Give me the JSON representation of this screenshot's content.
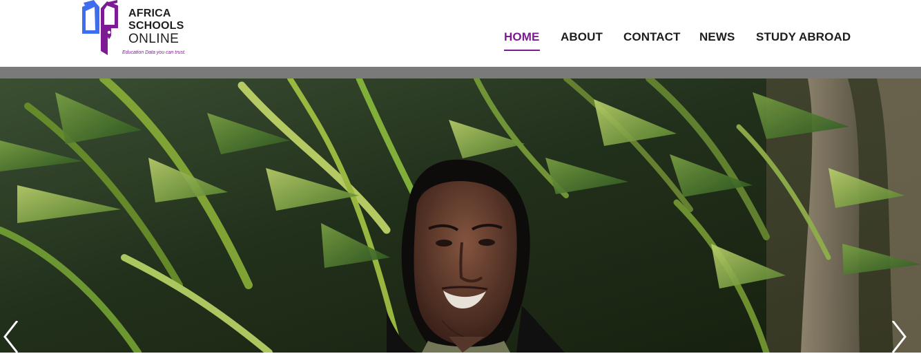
{
  "brand": {
    "name_line1": "AFRICA",
    "name_line2": "SCHOOLS",
    "name_line3": "ONLINE",
    "tagline": "Education Data you can trust."
  },
  "nav": {
    "items": [
      {
        "label": "HOME",
        "active": true
      },
      {
        "label": "ABOUT",
        "active": false
      },
      {
        "label": "CONTACT",
        "active": false
      },
      {
        "label": "NEWS",
        "active": false
      },
      {
        "label": "STUDY ABROAD",
        "active": false
      }
    ]
  },
  "colors": {
    "accent": "#7c1b93",
    "logo_blue": "#3e6df0",
    "logo_purple": "#7c1b93",
    "gray_strip": "#7a7a7a",
    "text": "#1d1d1d"
  },
  "icons": {
    "logo": "book-pen-logo",
    "prev": "chevron-left-icon",
    "next": "chevron-right-icon"
  }
}
